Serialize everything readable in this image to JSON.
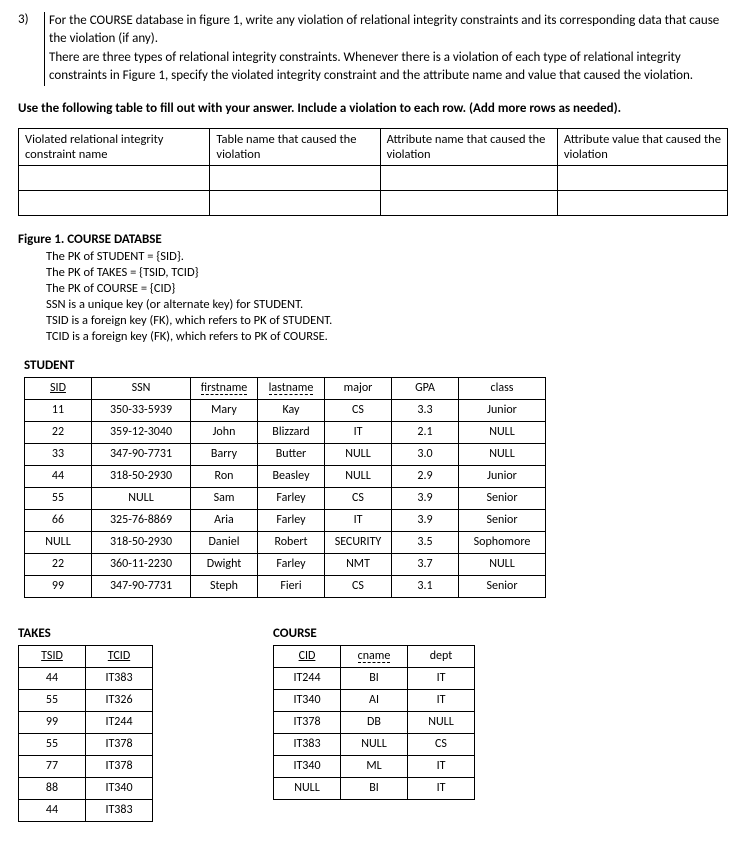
{
  "question": {
    "number": "3)",
    "p1": "For the COURSE database in figure 1, write any violation of relational integrity constraints and its corresponding data that cause the violation (if any).",
    "p2": "There are three types of relational integrity constraints. Whenever there is a violation of each type of relational integrity constraints in Figure 1, specify the violated integrity constraint and the attribute name and value that caused the violation."
  },
  "instruction": "Use the following table to fill out with your answer. Include a violation to each row. (Add more rows as needed).",
  "answer_table": {
    "h1": "Violated relational integrity constraint name",
    "h2": "Table name that caused the violation",
    "h3": "Attribute name that caused the violation",
    "h4": "Attribute value that caused the violation"
  },
  "figure": {
    "title": "Figure 1. COURSE DATABSE",
    "l1": "The PK of STUDENT = {SID}.",
    "l2": "The PK of TAKES = {TSID, TCID}",
    "l3": "The PK of COURSE = {CID}",
    "l4": "SSN is a unique key (or alternate key) for STUDENT.",
    "l5": "TSID is a foreign key (FK), which refers to PK of STUDENT.",
    "l6": "TCID is a foreign key (FK), which refers to PK of COURSE."
  },
  "student": {
    "label": "STUDENT",
    "headers": {
      "c1": "SID",
      "c2": "SSN",
      "c3": "firstname",
      "c4": "lastname",
      "c5": "major",
      "c6": "GPA",
      "c7": "class"
    },
    "rows": [
      {
        "c1": "11",
        "c2": "350-33-5939",
        "c3": "Mary",
        "c4": "Kay",
        "c5": "CS",
        "c6": "3.3",
        "c7": "Junior"
      },
      {
        "c1": "22",
        "c2": "359-12-3040",
        "c3": "John",
        "c4": "Blizzard",
        "c5": "IT",
        "c6": "2.1",
        "c7": "NULL"
      },
      {
        "c1": "33",
        "c2": "347-90-7731",
        "c3": "Barry",
        "c4": "Butter",
        "c5": "NULL",
        "c6": "3.0",
        "c7": "NULL"
      },
      {
        "c1": "44",
        "c2": "318-50-2930",
        "c3": "Ron",
        "c4": "Beasley",
        "c5": "NULL",
        "c6": "2.9",
        "c7": "Junior"
      },
      {
        "c1": "55",
        "c2": "NULL",
        "c3": "Sam",
        "c4": "Farley",
        "c5": "CS",
        "c6": "3.9",
        "c7": "Senior"
      },
      {
        "c1": "66",
        "c2": "325-76-8869",
        "c3": "Aria",
        "c4": "Farley",
        "c5": "IT",
        "c6": "3.9",
        "c7": "Senior"
      },
      {
        "c1": "NULL",
        "c2": "318-50-2930",
        "c3": "Daniel",
        "c4": "Robert",
        "c5": "SECURITY",
        "c6": "3.5",
        "c7": "Sophomore"
      },
      {
        "c1": "22",
        "c2": "360-11-2230",
        "c3": "Dwight",
        "c4": "Farley",
        "c5": "NMT",
        "c6": "3.7",
        "c7": "NULL"
      },
      {
        "c1": "99",
        "c2": "347-90-7731",
        "c3": "Steph",
        "c4": "Fieri",
        "c5": "CS",
        "c6": "3.1",
        "c7": "Senior"
      }
    ]
  },
  "takes": {
    "label": "TAKES",
    "headers": {
      "c1": "TSID",
      "c2": "TCID"
    },
    "rows": [
      {
        "c1": "44",
        "c2": "IT383"
      },
      {
        "c1": "55",
        "c2": "IT326"
      },
      {
        "c1": "99",
        "c2": "IT244"
      },
      {
        "c1": "55",
        "c2": "IT378"
      },
      {
        "c1": "77",
        "c2": "IT378"
      },
      {
        "c1": "88",
        "c2": "IT340"
      },
      {
        "c1": "44",
        "c2": "IT383"
      }
    ]
  },
  "course": {
    "label": "COURSE",
    "headers": {
      "c1": "CID",
      "c2": "cname",
      "c3": "dept"
    },
    "rows": [
      {
        "c1": "IT244",
        "c2": "BI",
        "c3": "IT"
      },
      {
        "c1": "IT340",
        "c2": "AI",
        "c3": "IT"
      },
      {
        "c1": "IT378",
        "c2": "DB",
        "c3": "NULL"
      },
      {
        "c1": "IT383",
        "c2": "NULL",
        "c3": "CS"
      },
      {
        "c1": "IT340",
        "c2": "ML",
        "c3": "IT"
      },
      {
        "c1": "NULL",
        "c2": "BI",
        "c3": "IT"
      }
    ]
  }
}
